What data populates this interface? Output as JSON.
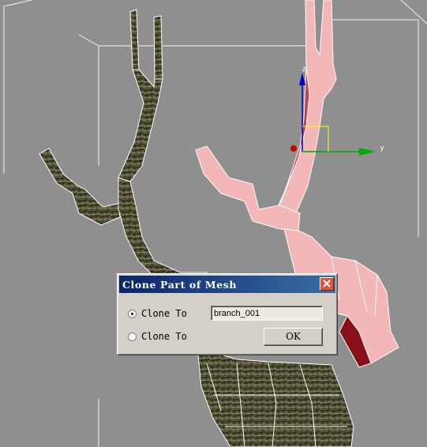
{
  "dialog": {
    "title": "Clone Part of Mesh",
    "option1_label": "Clone To",
    "option2_label": "Clone To",
    "name_value": "branch_001",
    "ok_label": "OK",
    "selected_option": 1
  },
  "gizmo": {
    "z_label": "z",
    "y_label": "y",
    "x_color": "#cc0000",
    "y_color": "#00aa00",
    "z_color": "#0000cc"
  },
  "colors": {
    "viewport_bg": "#8f8f8f",
    "selected_mesh": "#f4b7b7",
    "titlebar": "#0a246a"
  }
}
